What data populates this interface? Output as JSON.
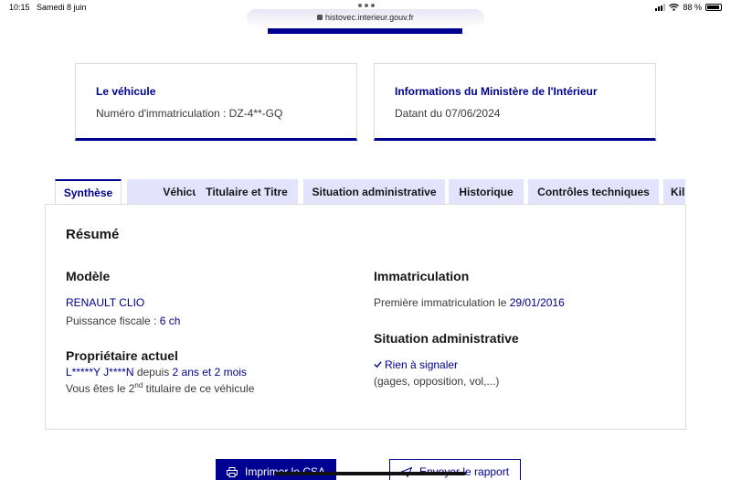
{
  "status_bar": {
    "time": "10:15",
    "date": "Samedi 8 juin",
    "battery": "88 %"
  },
  "browser": {
    "url": "histovec.interieur.gouv.fr"
  },
  "cards": {
    "vehicle": {
      "title": "Le véhicule",
      "text": "Numéro d'immatriculation : DZ-4**-GQ"
    },
    "ministry": {
      "title": "Informations du Ministère de l'Intérieur",
      "text": "Datant du 07/06/2024"
    }
  },
  "tabs": [
    {
      "label": "Synthèse",
      "active": true
    },
    {
      "label": "Véhicule",
      "active": false
    },
    {
      "label": "Titulaire et Titre",
      "active": false
    },
    {
      "label": "Situation administrative",
      "active": false
    },
    {
      "label": "Historique",
      "active": false
    },
    {
      "label": "Contrôles techniques",
      "active": false
    },
    {
      "label": "Kil",
      "active": false
    }
  ],
  "summary": {
    "heading": "Résumé",
    "model": {
      "heading": "Modèle",
      "name": "RENAULT CLIO",
      "power_label": "Puissance fiscale : ",
      "power_value": "6 ch"
    },
    "owner": {
      "heading": "Propriétaire actuel",
      "name": "L*****Y J****N",
      "since_label": " depuis ",
      "since_value": "2 ans et 2 mois",
      "rank_prefix": "Vous êtes le 2",
      "rank_sup": "nd",
      "rank_suffix": " titulaire de ce véhicule"
    },
    "registration": {
      "heading": "Immatriculation",
      "first_label": "Première immatriculation le ",
      "first_value": "29/01/2016"
    },
    "admin": {
      "heading": "Situation administrative",
      "status": "Rien à signaler",
      "detail": "(gages, opposition, vol,...)"
    }
  },
  "actions": {
    "print": "Imprimer le CSA",
    "send": "Envoyer le rapport"
  },
  "colors": {
    "accent": "#000091",
    "tab_bg": "#e3e3fd"
  }
}
